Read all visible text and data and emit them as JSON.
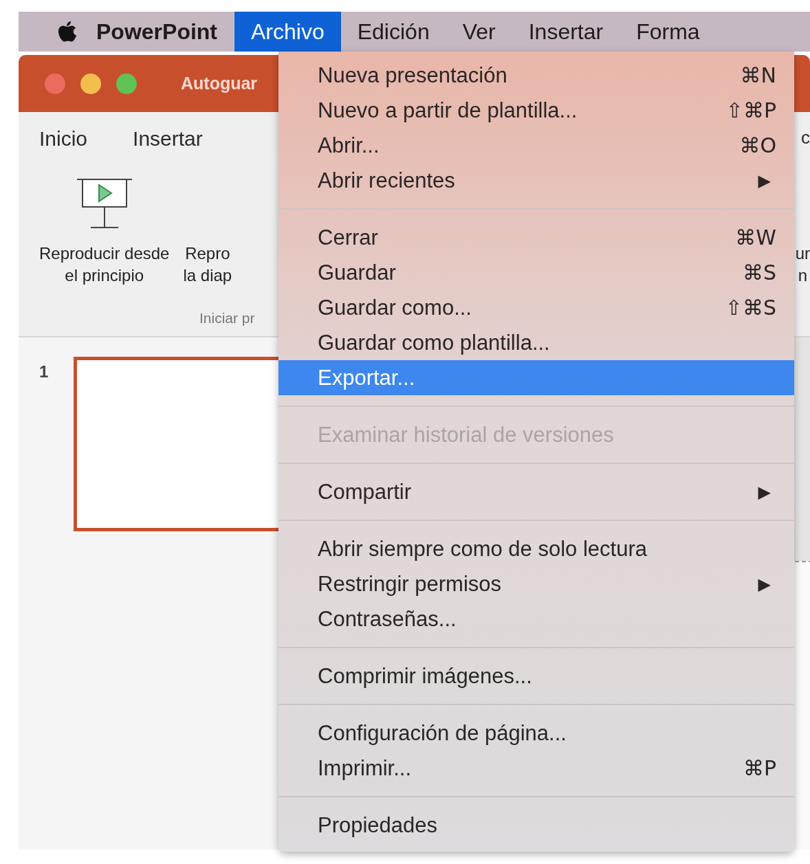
{
  "menu_bar": {
    "app_name": "PowerPoint",
    "menus": [
      {
        "label": "Archivo",
        "selected": true
      },
      {
        "label": "Edición",
        "selected": false
      },
      {
        "label": "Ver",
        "selected": false
      },
      {
        "label": "Insertar",
        "selected": false
      },
      {
        "label": "Forma",
        "selected": false
      }
    ]
  },
  "window": {
    "title": "Autoguar",
    "ribbon_tabs": [
      "Inicio",
      "Insertar",
      "c"
    ],
    "ribbon_buttons": [
      {
        "kind": "play",
        "lines": [
          "Reproducir desde",
          "el principio"
        ]
      },
      {
        "kind": "plain",
        "lines": [
          "Repro",
          "la diap"
        ]
      },
      {
        "kind": "edge",
        "lines": [
          "ur",
          "n"
        ]
      }
    ],
    "group_label": "Iniciar pr",
    "slides": [
      {
        "number": "1",
        "selected": true
      }
    ]
  },
  "file_menu": {
    "groups": [
      {
        "items": [
          {
            "label": "Nueva presentación",
            "shortcut": "⌘N",
            "selected": false,
            "disabled": false
          },
          {
            "label": "Nuevo a partir de plantilla...",
            "shortcut": "⇧⌘P",
            "selected": false,
            "disabled": false
          },
          {
            "label": "Abrir...",
            "shortcut": "⌘O",
            "selected": false,
            "disabled": false
          },
          {
            "label": "Abrir recientes",
            "submenu": "▶",
            "selected": false,
            "disabled": false
          }
        ]
      },
      {
        "items": [
          {
            "label": "Cerrar",
            "shortcut": "⌘W",
            "selected": false,
            "disabled": false
          },
          {
            "label": "Guardar",
            "shortcut": "⌘S",
            "selected": false,
            "disabled": false
          },
          {
            "label": "Guardar como...",
            "shortcut": "⇧⌘S",
            "selected": false,
            "disabled": false
          },
          {
            "label": "Guardar como plantilla...",
            "selected": false,
            "disabled": false
          },
          {
            "label": "Exportar...",
            "selected": true,
            "disabled": false
          }
        ]
      },
      {
        "items": [
          {
            "label": "Examinar historial de versiones",
            "selected": false,
            "disabled": true
          }
        ]
      },
      {
        "items": [
          {
            "label": "Compartir",
            "submenu": "▶",
            "selected": false,
            "disabled": false
          }
        ]
      },
      {
        "items": [
          {
            "label": "Abrir siempre como de solo lectura",
            "selected": false,
            "disabled": false
          },
          {
            "label": "Restringir permisos",
            "submenu": "▶",
            "selected": false,
            "disabled": false
          },
          {
            "label": "Contraseñas...",
            "selected": false,
            "disabled": false
          }
        ]
      },
      {
        "items": [
          {
            "label": "Comprimir imágenes...",
            "selected": false,
            "disabled": false
          }
        ]
      },
      {
        "items": [
          {
            "label": "Configuración de página...",
            "selected": false,
            "disabled": false
          },
          {
            "label": "Imprimir...",
            "shortcut": "⌘P",
            "selected": false,
            "disabled": false
          }
        ]
      },
      {
        "items": [
          {
            "label": "Propiedades",
            "selected": false,
            "disabled": false
          }
        ]
      }
    ]
  }
}
